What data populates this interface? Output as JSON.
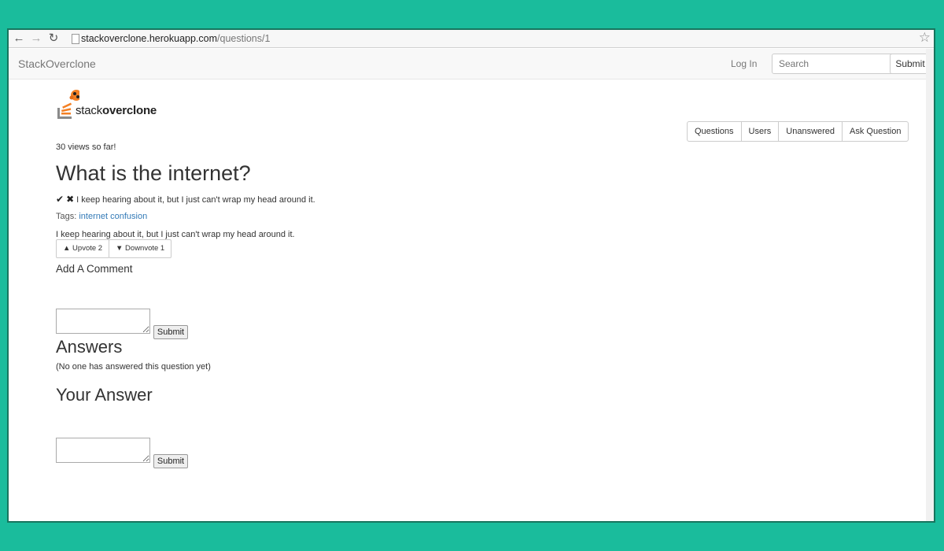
{
  "browser": {
    "url_host": "stackoverclone.herokuapp.com",
    "url_path": "/questions/1"
  },
  "navbar": {
    "brand": "StackOverclone",
    "login": "Log In",
    "search_placeholder": "Search",
    "submit": "Submit"
  },
  "logo": {
    "text_light": "stack",
    "text_bold": "overclone"
  },
  "nav_pills": [
    "Questions",
    "Users",
    "Unanswered",
    "Ask Question"
  ],
  "question": {
    "views": "30 views so far!",
    "title": "What is the internet?",
    "summary": "I keep hearing about it, but I just can't wrap my head around it.",
    "tags_label": "Tags:",
    "tags": "internet confusion",
    "body": "I keep hearing about it, but I just can't wrap my head around it.",
    "upvote": "Upvote 2",
    "downvote": "Downvote 1"
  },
  "comment": {
    "heading": "Add A Comment",
    "submit": "Submit"
  },
  "answers": {
    "heading": "Answers",
    "empty": "(No one has answered this question yet)"
  },
  "your_answer": {
    "heading": "Your Answer",
    "submit": "Submit"
  },
  "colors": {
    "background": "#1abc9c",
    "link": "#337ab7",
    "logo_orange": "#f48024"
  }
}
